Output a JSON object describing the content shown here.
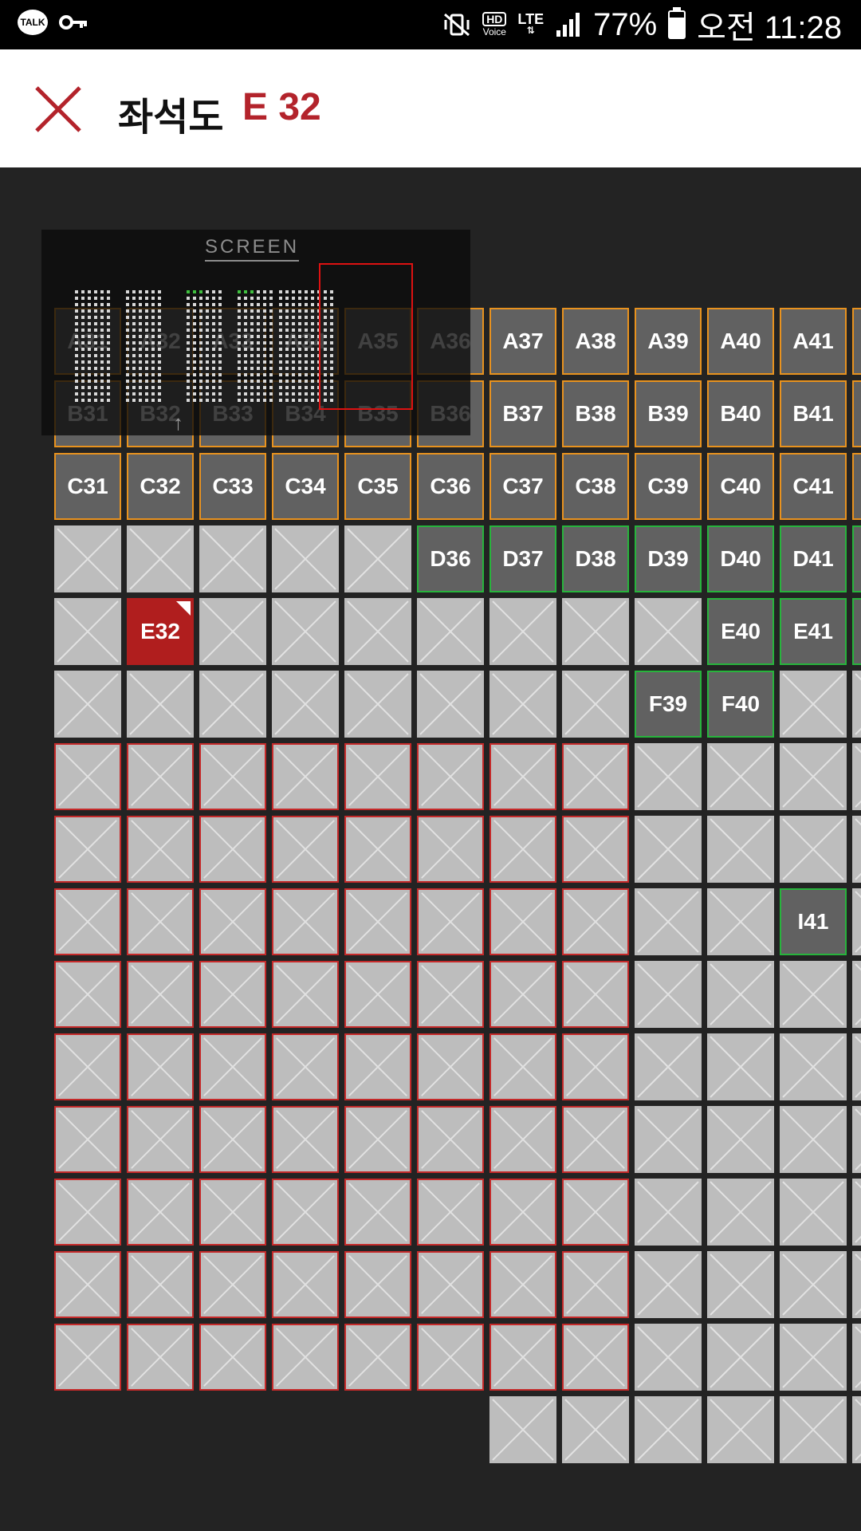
{
  "status_bar": {
    "left_icons": [
      "talk-icon",
      "key-icon"
    ],
    "talk_label": "TALK",
    "hd_label": "HD",
    "voice_label": "Voice",
    "lte_label": "LTE",
    "battery": "77%",
    "time": "오전 11:28",
    "icons": [
      "mute-vibrate-icon",
      "hd-voice-icon",
      "lte-icon",
      "signal-icon",
      "battery-icon"
    ]
  },
  "header": {
    "title": "좌석도",
    "seat": "E 32",
    "close_icon": "close-icon",
    "accent_color": "#b3232b"
  },
  "minimap": {
    "label": "SCREEN"
  },
  "seat_colors": {
    "available_fill": "#616161",
    "border_orange": "#e8921e",
    "border_green": "#27b43c",
    "selected": "#b01e1e",
    "sold": "#bdbdbd",
    "sold_red_border": "#c52a2a"
  },
  "seat_rows": [
    {
      "row": "A",
      "seats": [
        {
          "label": "A31",
          "state": "avail"
        },
        {
          "label": "A32",
          "state": "avail"
        },
        {
          "label": "A33",
          "state": "avail"
        },
        {
          "label": "A34",
          "state": "avail"
        },
        {
          "label": "A35",
          "state": "avail"
        },
        {
          "label": "A36",
          "state": "avail"
        },
        {
          "label": "A37",
          "state": "avail"
        },
        {
          "label": "A38",
          "state": "avail"
        },
        {
          "label": "A39",
          "state": "avail"
        },
        {
          "label": "A40",
          "state": "avail"
        },
        {
          "label": "A41",
          "state": "avail"
        },
        {
          "label": "",
          "state": "avail"
        }
      ]
    },
    {
      "row": "B",
      "seats": [
        {
          "label": "B31",
          "state": "avail"
        },
        {
          "label": "B32",
          "state": "avail"
        },
        {
          "label": "B33",
          "state": "avail"
        },
        {
          "label": "B34",
          "state": "avail"
        },
        {
          "label": "B35",
          "state": "avail"
        },
        {
          "label": "B36",
          "state": "avail"
        },
        {
          "label": "B37",
          "state": "avail"
        },
        {
          "label": "B38",
          "state": "avail"
        },
        {
          "label": "B39",
          "state": "avail"
        },
        {
          "label": "B40",
          "state": "avail"
        },
        {
          "label": "B41",
          "state": "avail"
        },
        {
          "label": "",
          "state": "avail"
        }
      ]
    },
    {
      "row": "C",
      "seats": [
        {
          "label": "C31",
          "state": "avail"
        },
        {
          "label": "C32",
          "state": "avail"
        },
        {
          "label": "C33",
          "state": "avail"
        },
        {
          "label": "C34",
          "state": "avail"
        },
        {
          "label": "C35",
          "state": "avail"
        },
        {
          "label": "C36",
          "state": "avail"
        },
        {
          "label": "C37",
          "state": "avail"
        },
        {
          "label": "C38",
          "state": "avail"
        },
        {
          "label": "C39",
          "state": "avail"
        },
        {
          "label": "C40",
          "state": "avail"
        },
        {
          "label": "C41",
          "state": "avail"
        },
        {
          "label": "",
          "state": "avail"
        }
      ]
    },
    {
      "row": "D",
      "seats": [
        {
          "label": "",
          "state": "sold"
        },
        {
          "label": "",
          "state": "sold"
        },
        {
          "label": "",
          "state": "sold"
        },
        {
          "label": "",
          "state": "sold"
        },
        {
          "label": "",
          "state": "sold"
        },
        {
          "label": "D36",
          "state": "avail-green"
        },
        {
          "label": "D37",
          "state": "avail-green"
        },
        {
          "label": "D38",
          "state": "avail-green"
        },
        {
          "label": "D39",
          "state": "avail-green"
        },
        {
          "label": "D40",
          "state": "avail-green"
        },
        {
          "label": "D41",
          "state": "avail-green"
        },
        {
          "label": "",
          "state": "avail-green"
        }
      ]
    },
    {
      "row": "E",
      "seats": [
        {
          "label": "",
          "state": "sold"
        },
        {
          "label": "E32",
          "state": "selected"
        },
        {
          "label": "",
          "state": "sold"
        },
        {
          "label": "",
          "state": "sold"
        },
        {
          "label": "",
          "state": "sold"
        },
        {
          "label": "",
          "state": "sold"
        },
        {
          "label": "",
          "state": "sold"
        },
        {
          "label": "",
          "state": "sold"
        },
        {
          "label": "",
          "state": "sold"
        },
        {
          "label": "E40",
          "state": "avail-green"
        },
        {
          "label": "E41",
          "state": "avail-green"
        },
        {
          "label": "",
          "state": "avail-green"
        }
      ]
    },
    {
      "row": "F",
      "seats": [
        {
          "label": "",
          "state": "sold"
        },
        {
          "label": "",
          "state": "sold"
        },
        {
          "label": "",
          "state": "sold"
        },
        {
          "label": "",
          "state": "sold"
        },
        {
          "label": "",
          "state": "sold"
        },
        {
          "label": "",
          "state": "sold"
        },
        {
          "label": "",
          "state": "sold"
        },
        {
          "label": "",
          "state": "sold"
        },
        {
          "label": "F39",
          "state": "avail-green"
        },
        {
          "label": "F40",
          "state": "avail-green"
        },
        {
          "label": "",
          "state": "sold"
        },
        {
          "label": "",
          "state": "sold"
        }
      ]
    },
    {
      "row": "G",
      "seats": [
        {
          "label": "",
          "state": "sold-red"
        },
        {
          "label": "",
          "state": "sold-red"
        },
        {
          "label": "",
          "state": "sold-red"
        },
        {
          "label": "",
          "state": "sold-red"
        },
        {
          "label": "",
          "state": "sold-red"
        },
        {
          "label": "",
          "state": "sold-red"
        },
        {
          "label": "",
          "state": "sold-red"
        },
        {
          "label": "",
          "state": "sold-red"
        },
        {
          "label": "",
          "state": "sold"
        },
        {
          "label": "",
          "state": "sold"
        },
        {
          "label": "",
          "state": "sold"
        },
        {
          "label": "",
          "state": "sold"
        }
      ]
    },
    {
      "row": "H",
      "seats": [
        {
          "label": "",
          "state": "sold-red"
        },
        {
          "label": "",
          "state": "sold-red"
        },
        {
          "label": "",
          "state": "sold-red"
        },
        {
          "label": "",
          "state": "sold-red"
        },
        {
          "label": "",
          "state": "sold-red"
        },
        {
          "label": "",
          "state": "sold-red"
        },
        {
          "label": "",
          "state": "sold-red"
        },
        {
          "label": "",
          "state": "sold-red"
        },
        {
          "label": "",
          "state": "sold"
        },
        {
          "label": "",
          "state": "sold"
        },
        {
          "label": "",
          "state": "sold"
        },
        {
          "label": "",
          "state": "sold"
        }
      ]
    },
    {
      "row": "I",
      "seats": [
        {
          "label": "",
          "state": "sold-red"
        },
        {
          "label": "",
          "state": "sold-red"
        },
        {
          "label": "",
          "state": "sold-red"
        },
        {
          "label": "",
          "state": "sold-red"
        },
        {
          "label": "",
          "state": "sold-red"
        },
        {
          "label": "",
          "state": "sold-red"
        },
        {
          "label": "",
          "state": "sold-red"
        },
        {
          "label": "",
          "state": "sold-red"
        },
        {
          "label": "",
          "state": "sold"
        },
        {
          "label": "",
          "state": "sold"
        },
        {
          "label": "I41",
          "state": "avail-green"
        },
        {
          "label": "",
          "state": "sold"
        }
      ]
    },
    {
      "row": "J",
      "seats": [
        {
          "label": "",
          "state": "sold-red"
        },
        {
          "label": "",
          "state": "sold-red"
        },
        {
          "label": "",
          "state": "sold-red"
        },
        {
          "label": "",
          "state": "sold-red"
        },
        {
          "label": "",
          "state": "sold-red"
        },
        {
          "label": "",
          "state": "sold-red"
        },
        {
          "label": "",
          "state": "sold-red"
        },
        {
          "label": "",
          "state": "sold-red"
        },
        {
          "label": "",
          "state": "sold"
        },
        {
          "label": "",
          "state": "sold"
        },
        {
          "label": "",
          "state": "sold"
        },
        {
          "label": "",
          "state": "sold"
        }
      ]
    },
    {
      "row": "K",
      "seats": [
        {
          "label": "",
          "state": "sold-red"
        },
        {
          "label": "",
          "state": "sold-red"
        },
        {
          "label": "",
          "state": "sold-red"
        },
        {
          "label": "",
          "state": "sold-red"
        },
        {
          "label": "",
          "state": "sold-red"
        },
        {
          "label": "",
          "state": "sold-red"
        },
        {
          "label": "",
          "state": "sold-red"
        },
        {
          "label": "",
          "state": "sold-red"
        },
        {
          "label": "",
          "state": "sold"
        },
        {
          "label": "",
          "state": "sold"
        },
        {
          "label": "",
          "state": "sold"
        },
        {
          "label": "",
          "state": "sold"
        }
      ]
    },
    {
      "row": "L",
      "seats": [
        {
          "label": "",
          "state": "sold-red"
        },
        {
          "label": "",
          "state": "sold-red"
        },
        {
          "label": "",
          "state": "sold-red"
        },
        {
          "label": "",
          "state": "sold-red"
        },
        {
          "label": "",
          "state": "sold-red"
        },
        {
          "label": "",
          "state": "sold-red"
        },
        {
          "label": "",
          "state": "sold-red"
        },
        {
          "label": "",
          "state": "sold-red"
        },
        {
          "label": "",
          "state": "sold"
        },
        {
          "label": "",
          "state": "sold"
        },
        {
          "label": "",
          "state": "sold"
        },
        {
          "label": "",
          "state": "sold"
        }
      ]
    },
    {
      "row": "M",
      "seats": [
        {
          "label": "",
          "state": "sold-red"
        },
        {
          "label": "",
          "state": "sold-red"
        },
        {
          "label": "",
          "state": "sold-red"
        },
        {
          "label": "",
          "state": "sold-red"
        },
        {
          "label": "",
          "state": "sold-red"
        },
        {
          "label": "",
          "state": "sold-red"
        },
        {
          "label": "",
          "state": "sold-red"
        },
        {
          "label": "",
          "state": "sold-red"
        },
        {
          "label": "",
          "state": "sold"
        },
        {
          "label": "",
          "state": "sold"
        },
        {
          "label": "",
          "state": "sold"
        },
        {
          "label": "",
          "state": "sold"
        }
      ]
    },
    {
      "row": "N",
      "seats": [
        {
          "label": "",
          "state": "sold-red"
        },
        {
          "label": "",
          "state": "sold-red"
        },
        {
          "label": "",
          "state": "sold-red"
        },
        {
          "label": "",
          "state": "sold-red"
        },
        {
          "label": "",
          "state": "sold-red"
        },
        {
          "label": "",
          "state": "sold-red"
        },
        {
          "label": "",
          "state": "sold-red"
        },
        {
          "label": "",
          "state": "sold-red"
        },
        {
          "label": "",
          "state": "sold"
        },
        {
          "label": "",
          "state": "sold"
        },
        {
          "label": "",
          "state": "sold"
        },
        {
          "label": "",
          "state": "sold"
        }
      ]
    },
    {
      "row": "O",
      "seats": [
        {
          "label": "",
          "state": "sold-red"
        },
        {
          "label": "",
          "state": "sold-red"
        },
        {
          "label": "",
          "state": "sold-red"
        },
        {
          "label": "",
          "state": "sold-red"
        },
        {
          "label": "",
          "state": "sold-red"
        },
        {
          "label": "",
          "state": "sold-red"
        },
        {
          "label": "",
          "state": "sold-red"
        },
        {
          "label": "",
          "state": "sold-red"
        },
        {
          "label": "",
          "state": "sold"
        },
        {
          "label": "",
          "state": "sold"
        },
        {
          "label": "",
          "state": "sold"
        },
        {
          "label": "",
          "state": "sold"
        }
      ]
    },
    {
      "row": "P",
      "seats": [
        {
          "label": "",
          "state": "none"
        },
        {
          "label": "",
          "state": "none"
        },
        {
          "label": "",
          "state": "none"
        },
        {
          "label": "",
          "state": "none"
        },
        {
          "label": "",
          "state": "none"
        },
        {
          "label": "",
          "state": "none"
        },
        {
          "label": "",
          "state": "sold"
        },
        {
          "label": "",
          "state": "sold"
        },
        {
          "label": "",
          "state": "sold"
        },
        {
          "label": "",
          "state": "sold"
        },
        {
          "label": "",
          "state": "sold"
        },
        {
          "label": "",
          "state": "sold"
        }
      ]
    }
  ]
}
